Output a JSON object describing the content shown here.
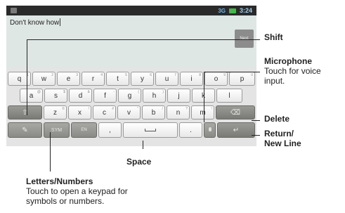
{
  "status_bar": {
    "time": "3:24",
    "network": "3G"
  },
  "editor": {
    "text": "Don't know how"
  },
  "next_key": {
    "label": "Next"
  },
  "keyboard": {
    "row1": [
      {
        "key": "q",
        "alt": "1"
      },
      {
        "key": "w",
        "alt": "2"
      },
      {
        "key": "e",
        "alt": "3"
      },
      {
        "key": "r",
        "alt": "4"
      },
      {
        "key": "t",
        "alt": "5"
      },
      {
        "key": "y",
        "alt": "6"
      },
      {
        "key": "u",
        "alt": "7"
      },
      {
        "key": "i",
        "alt": "8"
      },
      {
        "key": "o",
        "alt": "9"
      },
      {
        "key": "p",
        "alt": "0"
      }
    ],
    "row2": [
      {
        "key": "a",
        "alt": "@"
      },
      {
        "key": "s",
        "alt": "$"
      },
      {
        "key": "d",
        "alt": "&"
      },
      {
        "key": "f",
        "alt": "-"
      },
      {
        "key": "g",
        "alt": "("
      },
      {
        "key": "h",
        "alt": ")"
      },
      {
        "key": "j",
        "alt": ""
      },
      {
        "key": "k",
        "alt": ""
      },
      {
        "key": "l",
        "alt": ""
      }
    ],
    "row3": [
      {
        "key": "z",
        "alt": "©"
      },
      {
        "key": "x",
        "alt": "!"
      },
      {
        "key": "c",
        "alt": "#"
      },
      {
        "key": "v",
        "alt": "\""
      },
      {
        "key": "b",
        "alt": "/"
      },
      {
        "key": "n",
        "alt": "?"
      },
      {
        "key": "m",
        "alt": "!"
      }
    ],
    "sym_label": "SYM",
    "lang_label": "EN",
    "comma": ",",
    "period": ".",
    "shift_icon": "shift-arrow-icon",
    "delete_icon": "backspace-icon",
    "enter_icon": "return-arrow-icon",
    "mic_icon": "microphone-icon",
    "settings_icon": "settings-icon",
    "shift_glyph": "⇧",
    "delete_glyph": "⌫",
    "enter_glyph": "↵",
    "settings_glyph": "✎"
  },
  "callouts": {
    "shift": {
      "title": "Shift"
    },
    "microphone": {
      "title": "Microphone",
      "desc_1": "Touch for voice",
      "desc_2": "input."
    },
    "delete": {
      "title": "Delete"
    },
    "return": {
      "title_1": "Return/",
      "title_2": "New Line"
    },
    "space": {
      "title": "Space"
    },
    "letters": {
      "title": "Letters/Numbers",
      "desc_1": "Touch to open a keypad for",
      "desc_2": "symbols or numbers."
    }
  },
  "colors": {
    "text_area_bg": "#dfe7e5",
    "function_key_bg": "#8a8a86",
    "callout_line": "#222222"
  }
}
